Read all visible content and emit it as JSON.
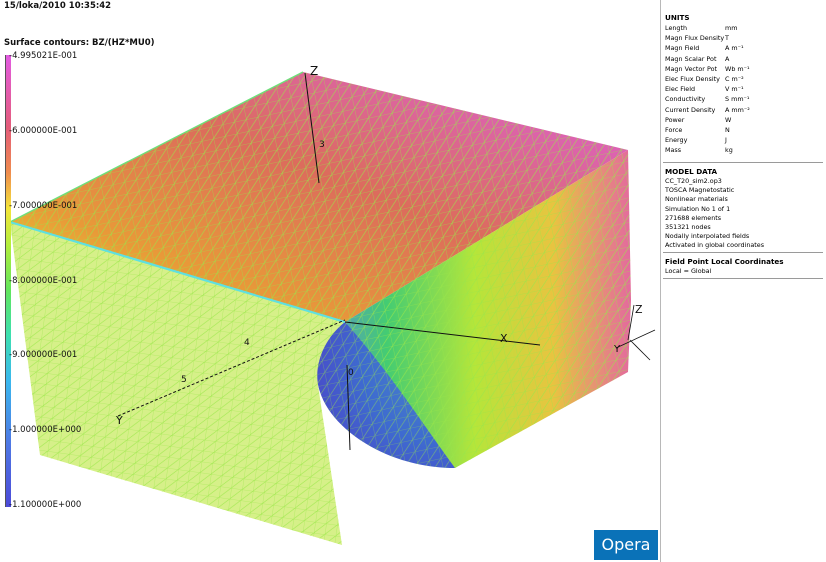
{
  "viewport": {
    "timestamp": "15/loka/2010 10:35:42",
    "contour_title": "Surface contours: BZ/(HZ*MU0)",
    "colorbar_labels": [
      "-4.995021E-001",
      "-6.000000E-001",
      "-7.000000E-001",
      "-8.000000E-001",
      "-9.000000E-001",
      "-1.000000E+000",
      "-1.100000E+000"
    ],
    "colorbar_colors": {
      "top": "#e25be2",
      "bottom": "#4c4ad8"
    },
    "axis_labels": {
      "z_top": "Z",
      "tick_3": "3",
      "tick_4": "4",
      "tick_5": "5",
      "y_left": "Y",
      "x_right": "X",
      "origin": "0",
      "z_right": "Z",
      "y_right": "Y"
    },
    "brand": "Opera"
  },
  "panel": {
    "units": {
      "title": "UNITS",
      "rows": [
        {
          "k": "Length",
          "v": "mm"
        },
        {
          "k": "Magn Flux Density",
          "v": "T"
        },
        {
          "k": "Magn Field",
          "v": "A m⁻¹"
        },
        {
          "k": "Magn Scalar Pot",
          "v": "A"
        },
        {
          "k": "Magn Vector Pot",
          "v": "Wb m⁻¹"
        },
        {
          "k": "Elec Flux Density",
          "v": "C m⁻²"
        },
        {
          "k": "Elec Field",
          "v": "V m⁻¹"
        },
        {
          "k": "Conductivity",
          "v": "S mm⁻¹"
        },
        {
          "k": "Current Density",
          "v": "A mm⁻²"
        },
        {
          "k": "Power",
          "v": "W"
        },
        {
          "k": "Force",
          "v": "N"
        },
        {
          "k": "Energy",
          "v": "J"
        },
        {
          "k": "Mass",
          "v": "kg"
        }
      ]
    },
    "model": {
      "title": "MODEL DATA",
      "lines": [
        "CC_T20_sim2.op3",
        "TOSCA Magnetostatic",
        "Nonlinear materials",
        "Simulation No 1 of 1",
        "271688 elements",
        "351321 nodes",
        "Nodally interpolated fields",
        "Activated in global coordinates"
      ]
    },
    "fieldpoint": {
      "title": "Field Point Local Coordinates",
      "lines": [
        "Local = Global"
      ]
    }
  }
}
